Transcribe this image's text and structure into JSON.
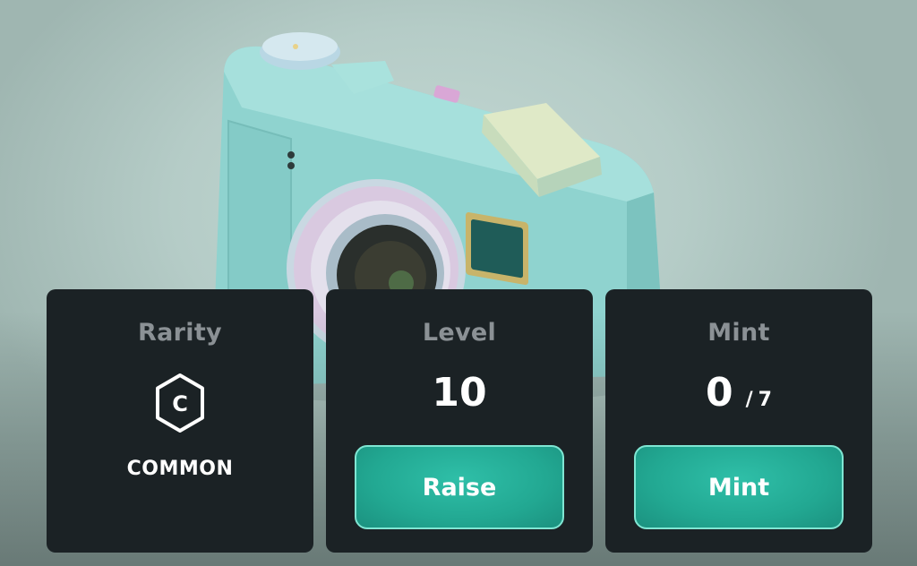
{
  "cards": {
    "rarity": {
      "title": "Rarity",
      "badge_letter": "C",
      "value": "COMMON",
      "icon": "hexagon-c-icon"
    },
    "level": {
      "title": "Level",
      "value": "10",
      "button_label": "Raise"
    },
    "mint": {
      "title": "Mint",
      "current": "0",
      "separator": "/",
      "max": "7",
      "button_label": "Mint"
    }
  },
  "colors": {
    "card_bg": "#1b2225",
    "title_gray": "#8b9195",
    "button_teal": "#22a892",
    "button_border": "#7fe6d3",
    "scene_bg": "#b9cfca"
  }
}
